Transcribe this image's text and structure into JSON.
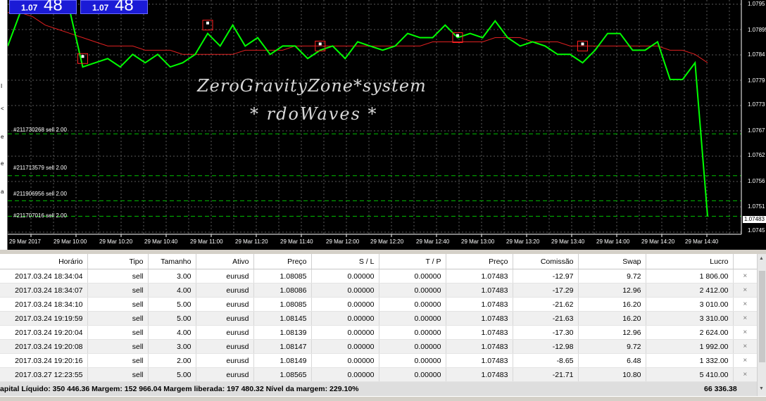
{
  "bid": {
    "small": "1.07",
    "big": "48"
  },
  "watermark": {
    "line1": "ZeroGravityZone*system",
    "line2": "* rdoWaves *"
  },
  "price_axis": [
    "1.0795",
    "1.07895",
    "1.0784",
    "1.0779",
    "1.0773",
    "1.0767",
    "1.0762",
    "1.0756",
    "1.0751",
    "1.07483",
    "1.0745"
  ],
  "current_price": "1.07483",
  "time_axis": [
    "29 Mar 2017",
    "29 Mar 10:00",
    "29 Mar 10:20",
    "29 Mar 10:40",
    "29 Mar 11:00",
    "29 Mar 11:20",
    "29 Mar 11:40",
    "29 Mar 12:00",
    "29 Mar 12:20",
    "29 Mar 12:40",
    "29 Mar 13:00",
    "29 Mar 13:20",
    "29 Mar 13:40",
    "29 Mar 14:00",
    "29 Mar 14:20",
    "29 Mar 14:40"
  ],
  "order_lines": [
    {
      "label": "#211730268 sell 2.00"
    },
    {
      "label": "#211713579 sell 2.00"
    },
    {
      "label": "#211906956 sell 2.00"
    },
    {
      "label": "#211707016 sell 2.00"
    }
  ],
  "colors": {
    "price_line": "#00ff00",
    "ma_line": "#e02020",
    "grid": "#5a5a5a",
    "order_line": "#00c000",
    "bid_box": "#1b1bd6"
  },
  "chart_data": {
    "type": "line",
    "series": [
      {
        "values": [
          1.0789,
          1.0797,
          1.0797,
          1.0797,
          1.0797,
          1.0797,
          1.0784,
          1.0785,
          1.0786,
          1.0784,
          1.0787,
          1.0785,
          1.0787,
          1.0784,
          1.0785,
          1.0787,
          1.0792,
          1.0789,
          1.0794,
          1.0789,
          1.0791,
          1.0787,
          1.0789,
          1.0789,
          1.0786,
          1.0788,
          1.0789,
          1.0786,
          1.079,
          1.0789,
          1.0788,
          1.0789,
          1.0792,
          1.0791,
          1.0791,
          1.0794,
          1.0791,
          1.0792,
          1.0791,
          1.0795,
          1.0791,
          1.0789,
          1.079,
          1.0789,
          1.0787,
          1.0787,
          1.0785,
          1.0788,
          1.0792,
          1.0792,
          1.0788,
          1.0788,
          1.079,
          1.0781,
          1.0781,
          1.0785,
          1.07483
        ]
      },
      {
        "values": [
          1.0797,
          1.0797,
          1.0796,
          1.0794,
          1.0793,
          1.0792,
          1.0791,
          1.079,
          1.0789,
          1.0789,
          1.0789,
          1.0788,
          1.0788,
          1.0788,
          1.0787,
          1.0787,
          1.0787,
          1.0787,
          1.0787,
          1.0788,
          1.0788,
          1.0788,
          1.0788,
          1.0789,
          1.0789,
          1.0789,
          1.0789,
          1.0789,
          1.0789,
          1.0789,
          1.0789,
          1.0789,
          1.0789,
          1.0789,
          1.079,
          1.079,
          1.079,
          1.079,
          1.079,
          1.0791,
          1.0791,
          1.0791,
          1.079,
          1.079,
          1.079,
          1.0789,
          1.0789,
          1.0789,
          1.0789,
          1.0789,
          1.0789,
          1.0789,
          1.0789,
          1.0788,
          1.0788,
          1.0787,
          1.0785
        ]
      }
    ],
    "markers": [
      [
        6,
        1.0786
      ],
      [
        16,
        1.0794
      ],
      [
        25,
        1.0789
      ],
      [
        36,
        1.0791
      ],
      [
        46,
        1.0789
      ]
    ],
    "order_prices": [
      1.0768,
      1.0758,
      1.0752,
      1.07483
    ],
    "ylim": [
      1.0744,
      1.08
    ],
    "grid": true
  },
  "table": {
    "headers": [
      "Horário",
      "Tipo",
      "Tamanho",
      "Ativo",
      "Preço",
      "S / L",
      "T / P",
      "Preço",
      "Comissão",
      "Swap",
      "Lucro"
    ],
    "rows": [
      [
        "2017.03.24 18:34:04",
        "sell",
        "3.00",
        "eurusd",
        "1.08085",
        "0.00000",
        "0.00000",
        "1.07483",
        "-12.97",
        "9.72",
        "1 806.00"
      ],
      [
        "2017.03.24 18:34:07",
        "sell",
        "4.00",
        "eurusd",
        "1.08086",
        "0.00000",
        "0.00000",
        "1.07483",
        "-17.29",
        "12.96",
        "2 412.00"
      ],
      [
        "2017.03.24 18:34:10",
        "sell",
        "5.00",
        "eurusd",
        "1.08085",
        "0.00000",
        "0.00000",
        "1.07483",
        "-21.62",
        "16.20",
        "3 010.00"
      ],
      [
        "2017.03.24 19:19:59",
        "sell",
        "5.00",
        "eurusd",
        "1.08145",
        "0.00000",
        "0.00000",
        "1.07483",
        "-21.63",
        "16.20",
        "3 310.00"
      ],
      [
        "2017.03.24 19:20:04",
        "sell",
        "4.00",
        "eurusd",
        "1.08139",
        "0.00000",
        "0.00000",
        "1.07483",
        "-17.30",
        "12.96",
        "2 624.00"
      ],
      [
        "2017.03.24 19:20:08",
        "sell",
        "3.00",
        "eurusd",
        "1.08147",
        "0.00000",
        "0.00000",
        "1.07483",
        "-12.98",
        "9.72",
        "1 992.00"
      ],
      [
        "2017.03.24 19:20:16",
        "sell",
        "2.00",
        "eurusd",
        "1.08149",
        "0.00000",
        "0.00000",
        "1.07483",
        "-8.65",
        "6.48",
        "1 332.00"
      ],
      [
        "2017.03.27 12:23:55",
        "sell",
        "5.00",
        "eurusd",
        "1.08565",
        "0.00000",
        "0.00000",
        "1.07483",
        "-21.71",
        "10.80",
        "5 410.00"
      ]
    ],
    "close_icon": "×",
    "summary": "apital Líquido: 350 446.36  Margem: 152 966.04  Margem liberada: 197 480.32  Nível da margem: 229.10%",
    "total_lucro": "66 336.38"
  }
}
